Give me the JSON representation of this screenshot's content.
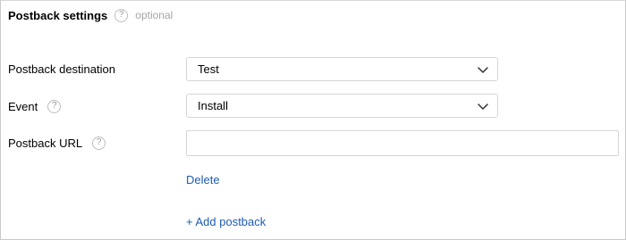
{
  "header": {
    "title": "Postback settings",
    "help_glyph": "?",
    "optional_label": "optional"
  },
  "fields": {
    "destination": {
      "label": "Postback destination",
      "value": "Test"
    },
    "event": {
      "label": "Event",
      "help_glyph": "?",
      "value": "Install"
    },
    "url": {
      "label": "Postback URL",
      "help_glyph": "?",
      "value": "",
      "placeholder": ""
    }
  },
  "actions": {
    "delete_label": "Delete",
    "add_label": "+ Add postback"
  },
  "colors": {
    "link": "#1d5bb4",
    "border": "#d6d6d6",
    "muted": "#a6a6a6"
  },
  "icons": {
    "help": "question-circle-icon",
    "dropdown": "chevron-down-icon"
  }
}
